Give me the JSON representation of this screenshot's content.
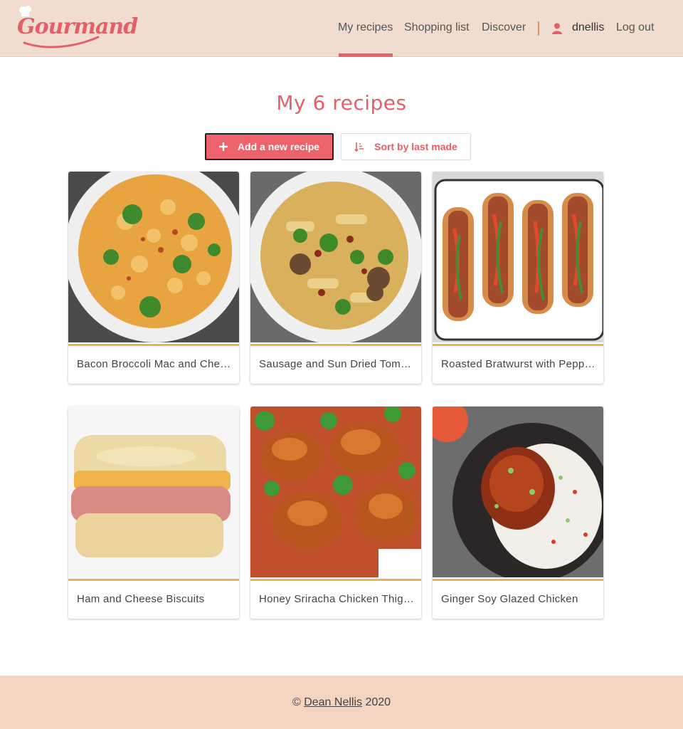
{
  "header": {
    "logo_text": "Gourmand",
    "nav": {
      "my_recipes": "My recipes",
      "shopping_list": "Shopping list",
      "discover": "Discover",
      "username": "dnellis",
      "logout": "Log out"
    }
  },
  "main": {
    "title": "My 6 recipes",
    "add_button": "Add a new recipe",
    "sort_button": "Sort by last made",
    "recipes": [
      {
        "name": "Bacon Broccoli Mac and Cheese",
        "image": "mac-and-cheese-bowl"
      },
      {
        "name": "Sausage and Sun Dried Tomato Pasta",
        "image": "sausage-pasta-bowl"
      },
      {
        "name": "Roasted Bratwurst with Peppers",
        "image": "bratwurst-tray"
      },
      {
        "name": "Ham and Cheese Biscuits",
        "image": "ham-cheese-biscuit"
      },
      {
        "name": "Honey Sriracha Chicken Thighs",
        "image": "honey-sriracha-chicken"
      },
      {
        "name": "Ginger Soy Glazed Chicken",
        "image": "ginger-soy-chicken-rice"
      }
    ]
  },
  "footer": {
    "copyright_symbol": "©",
    "author": "Dean Nellis",
    "year": "2020"
  },
  "colors": {
    "header_bg": "#f1dcd0",
    "accent": "#e2606a",
    "card_underline": "#e9b25e",
    "footer_bg": "#f2d4c0"
  }
}
